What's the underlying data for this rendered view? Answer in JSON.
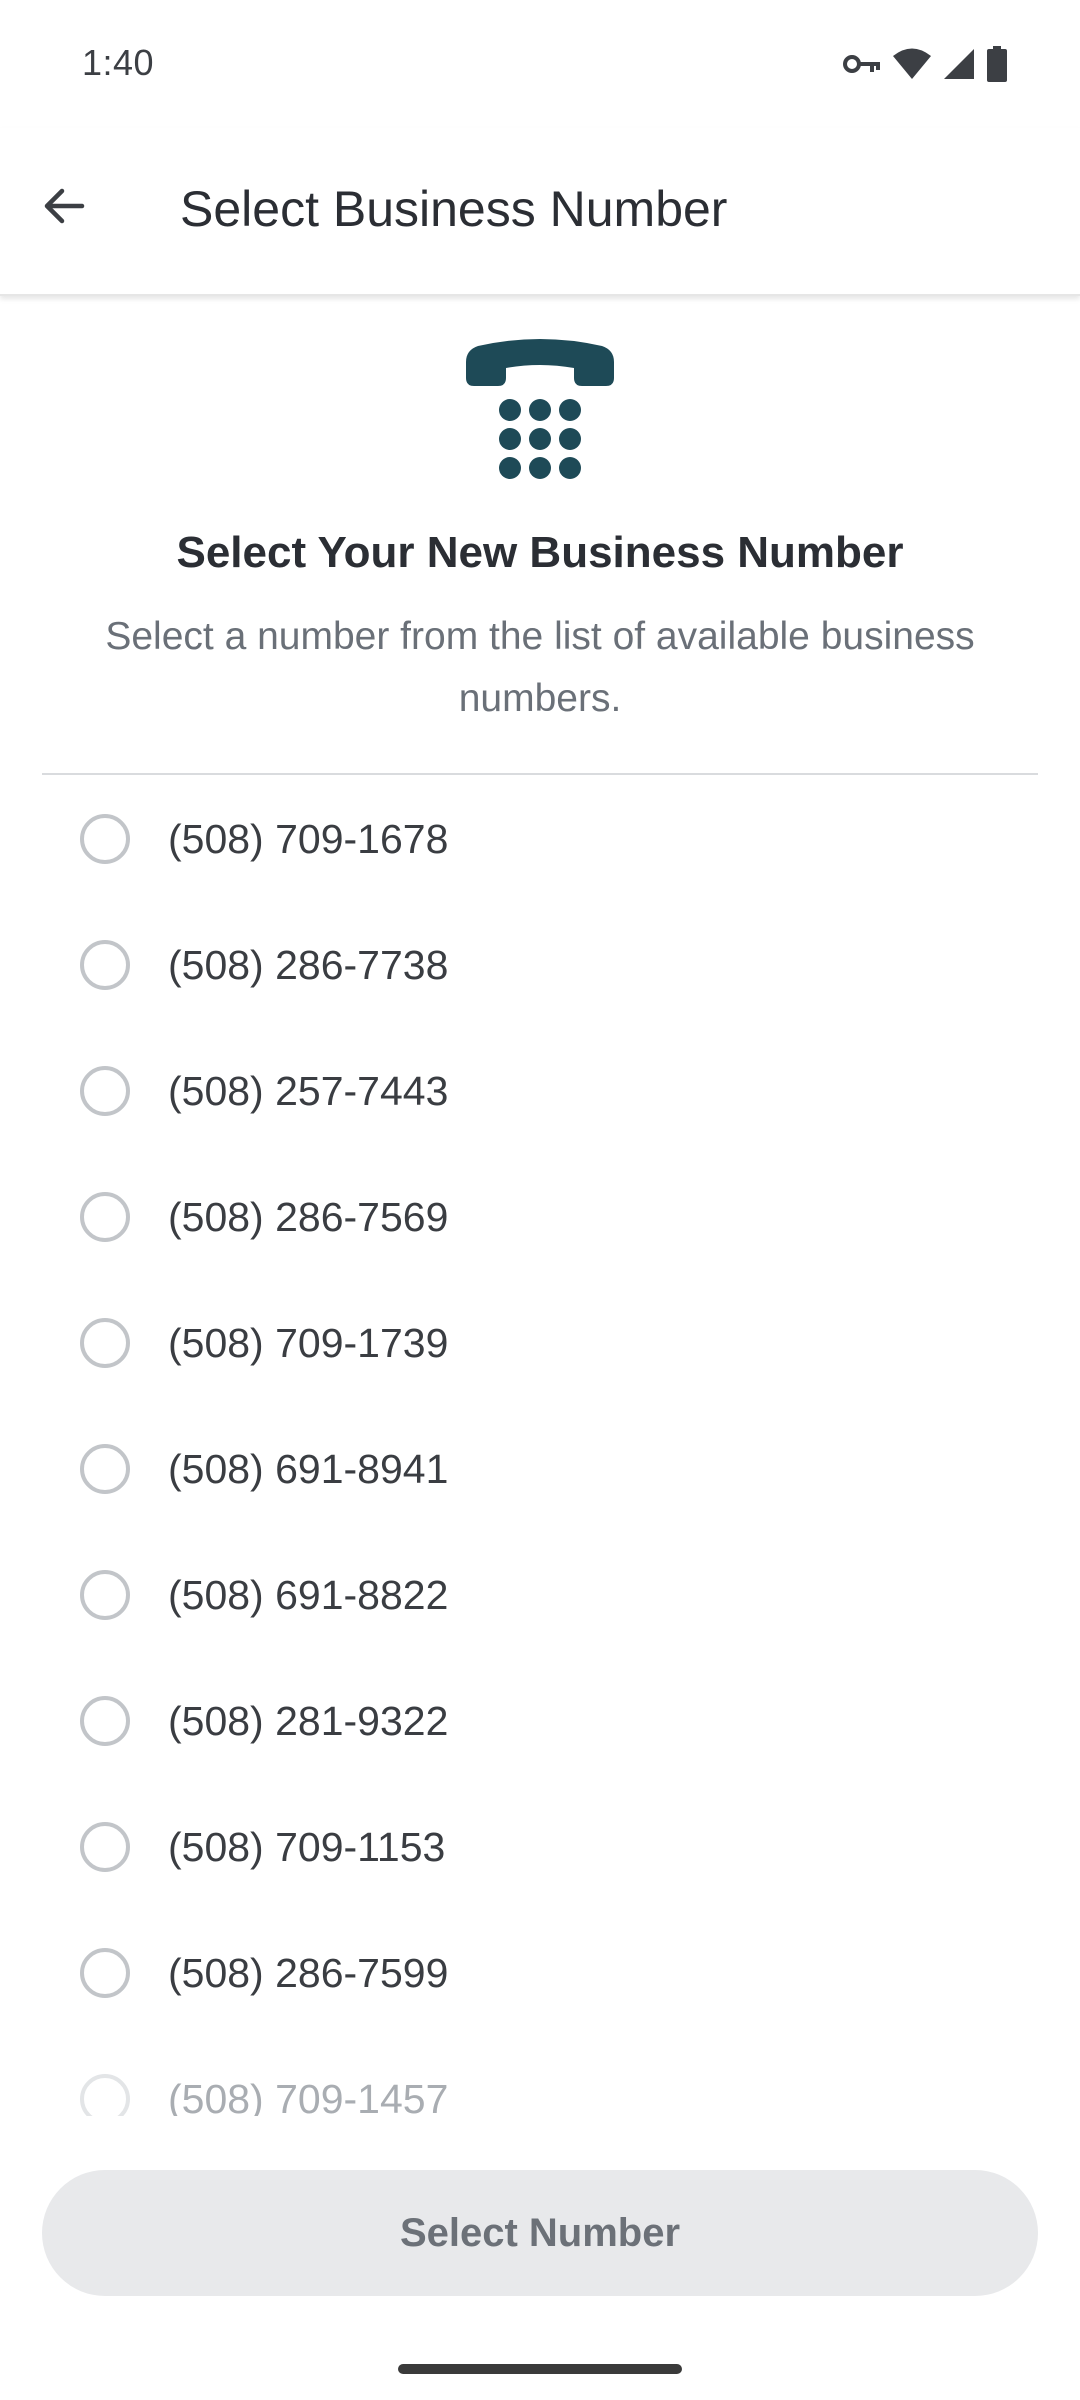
{
  "status_bar": {
    "time": "1:40",
    "icons": [
      "vpn-key-icon",
      "wifi-icon",
      "cell-signal-icon",
      "battery-icon"
    ]
  },
  "app_bar": {
    "back_icon": "arrow-back-icon",
    "title": "Select Business Number"
  },
  "hero": {
    "icon": "desk-phone-icon",
    "title": "Select Your New Business Number",
    "subtitle": "Select a number from the list of available business numbers."
  },
  "numbers": [
    "(508) 709-1678",
    "(508) 286-7738",
    "(508) 257-7443",
    "(508) 286-7569",
    "(508) 709-1739",
    "(508) 691-8941",
    "(508) 691-8822",
    "(508) 281-9322",
    "(508) 709-1153",
    "(508) 286-7599",
    "(508) 709-1457"
  ],
  "selected_index": null,
  "footer": {
    "select_button_label": "Select Number",
    "select_button_enabled": false
  },
  "colors": {
    "icon_teal": "#1e4a57",
    "radio_border": "#c2c5c9",
    "button_bg_disabled": "#e8e9eb"
  }
}
